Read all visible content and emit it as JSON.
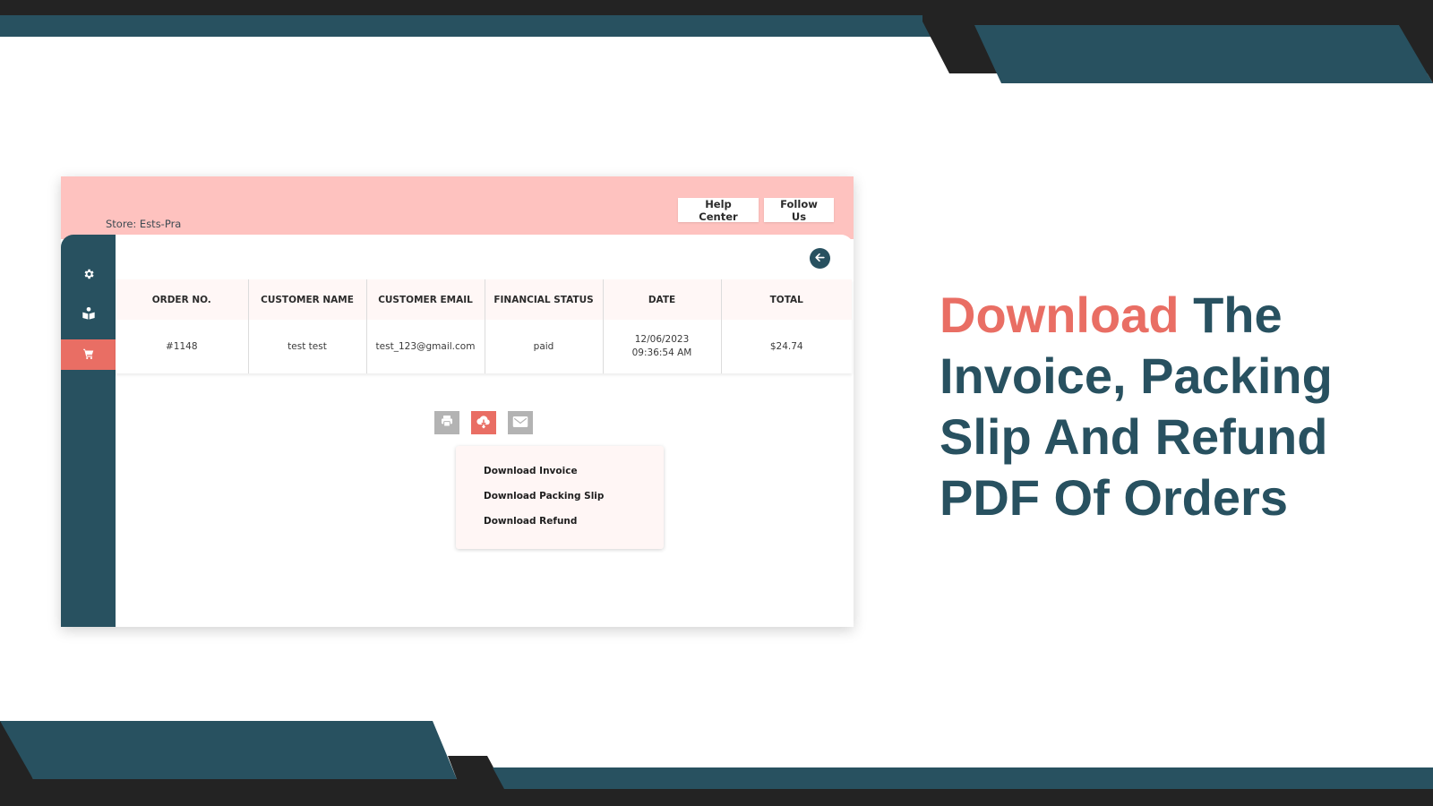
{
  "header": {
    "store_label": "Store: Ests-Pra",
    "help_center": "Help Center",
    "follow_us": "Follow Us"
  },
  "sidebar": {
    "items": [
      {
        "name": "settings",
        "icon": "gear-icon",
        "active": false
      },
      {
        "name": "guide",
        "icon": "reader-icon",
        "active": false
      },
      {
        "name": "orders",
        "icon": "cart-icon",
        "active": true
      }
    ]
  },
  "table": {
    "columns": [
      "ORDER NO.",
      "CUSTOMER NAME",
      "CUSTOMER EMAIL",
      "FINANCIAL STATUS",
      "DATE",
      "TOTAL"
    ],
    "rows": [
      {
        "order_no": "#1148",
        "customer_name": "test test",
        "customer_email": "test_123@gmail.com",
        "financial_status": "paid",
        "date": "12/06/2023",
        "time": "09:36:54 AM",
        "total": "$24.74"
      }
    ]
  },
  "actions": {
    "print": "printer-icon",
    "download": "cloud-download-icon",
    "email": "envelope-icon"
  },
  "dropdown": {
    "items": [
      "Download Invoice",
      "Download Packing Slip",
      "Download Refund"
    ]
  },
  "headline": {
    "accent": "Download",
    "rest": " The Invoice, Packing Slip And Refund PDF Of Orders"
  },
  "colors": {
    "teal": "#285160",
    "coral": "#e96e64",
    "pink": "#fec2bf",
    "dark": "#232323"
  }
}
